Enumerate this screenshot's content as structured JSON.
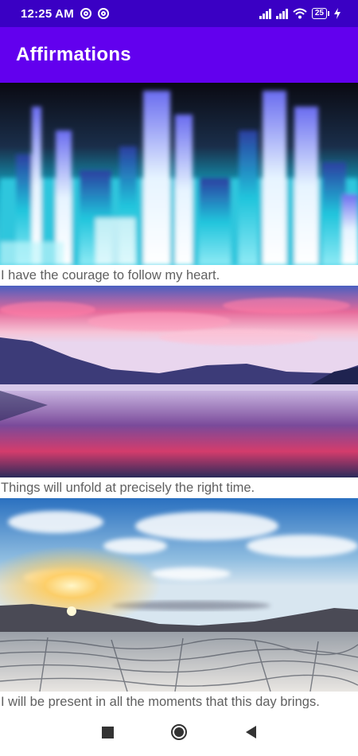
{
  "status_bar": {
    "time": "12:25 AM",
    "battery": "25",
    "icons": [
      "sync-icon",
      "sync-icon",
      "signal-icon",
      "signal-icon",
      "wifi-icon",
      "battery-icon",
      "charging-icon"
    ]
  },
  "app_bar": {
    "title": "Affirmations",
    "color": "#6200ee"
  },
  "affirmations": [
    {
      "text": "I have the courage to follow my heart.",
      "image": "ice-crystals-photo"
    },
    {
      "text": "Things will unfold at precisely the right time.",
      "image": "lake-sunset-photo"
    },
    {
      "text": "I will be present in all the moments that this day brings.",
      "image": "salt-flat-sunrise-photo"
    }
  ],
  "nav_bar": {
    "icons": [
      "recents-icon",
      "home-icon",
      "back-icon"
    ]
  }
}
